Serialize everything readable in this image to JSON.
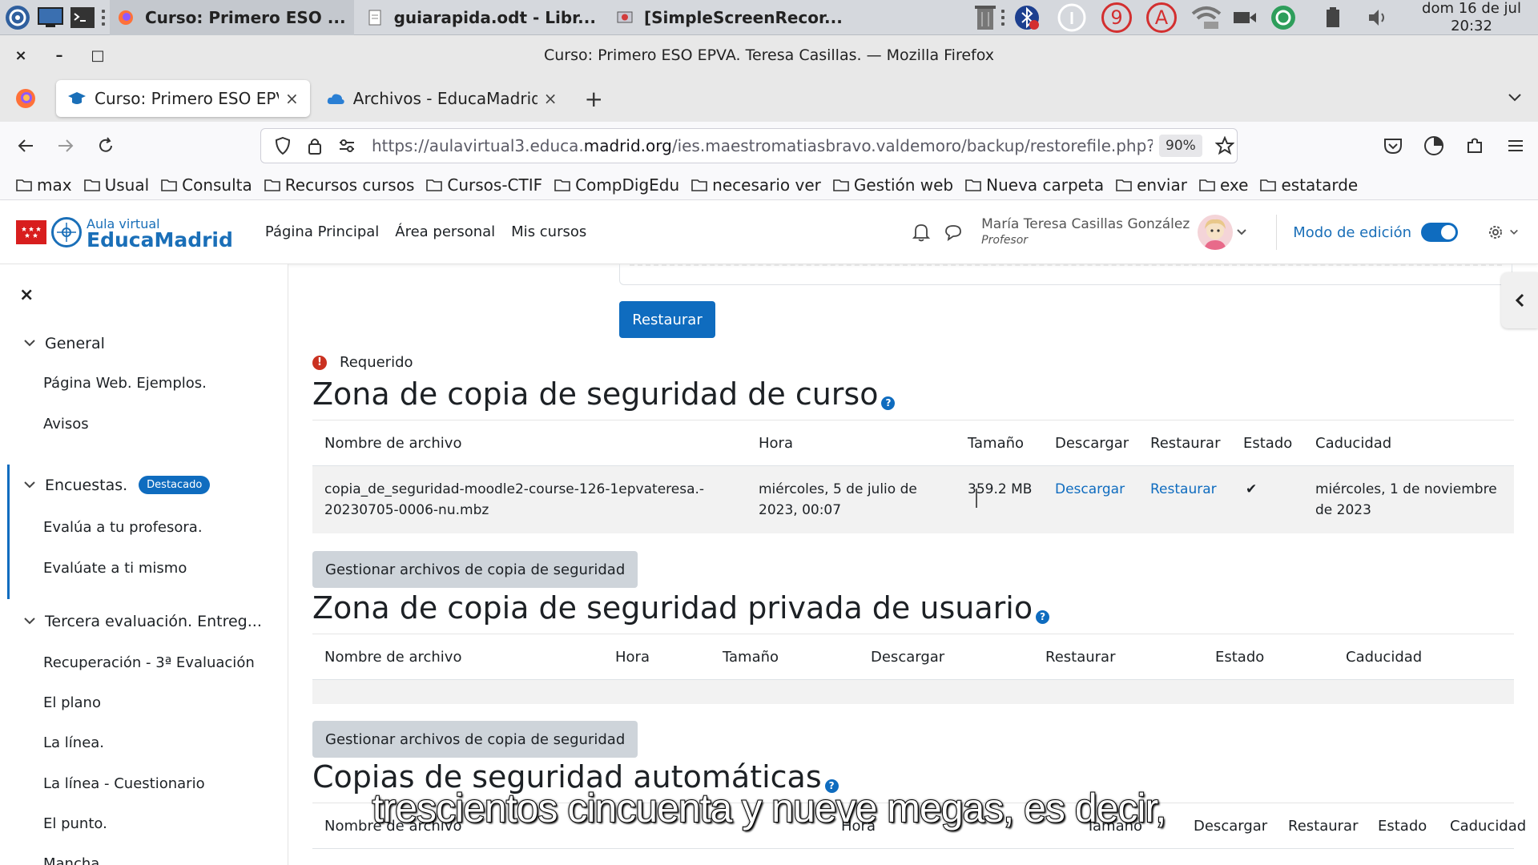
{
  "taskbar": {
    "tasks": [
      {
        "label": "Curso: Primero ESO ..."
      },
      {
        "label": "guiarapida.odt - Libr..."
      },
      {
        "label": "[SimpleScreenRecor..."
      }
    ],
    "tray_badges": {
      "red_number": "9",
      "red_letter": "A"
    },
    "clock_date": "dom 16 de jul",
    "clock_time": "20:32"
  },
  "window": {
    "title": "Curso: Primero ESO EPVA. Teresa Casillas. — Mozilla Firefox",
    "close": "×",
    "minimize": "–",
    "maximize": "□"
  },
  "tabs": [
    {
      "title": "Curso: Primero ESO EPVA",
      "close": "×"
    },
    {
      "title": "Archivos - EducaMadrid C",
      "close": "×"
    }
  ],
  "newtab": "+",
  "urlbar": {
    "prefix": "https://aulavirtual3.educa.",
    "domain": "madrid.org",
    "path": "/ies.maestromatiasbravo.valdemoro/backup/restorefile.php?c",
    "zoom": "90%"
  },
  "bookmarks": [
    "max",
    "Usual",
    "Consulta",
    "Recursos cursos",
    "Cursos-CTIF",
    "CompDigEdu",
    "necesario ver",
    "Gestión web",
    "Nueva carpeta",
    "enviar",
    "exe",
    "estatarde"
  ],
  "moodle_header": {
    "logo_line1": "Aula virtual",
    "logo_line2": "EducaMadrid",
    "nav": [
      "Página Principal",
      "Área personal",
      "Mis cursos"
    ],
    "user_name": "María Teresa Casillas González",
    "user_role": "Profesor",
    "edit_mode_label": "Modo de edición",
    "edit_mode_on": true
  },
  "drawer": {
    "close": "×",
    "sections": [
      {
        "title": "General",
        "items": [
          "Página Web. Ejemplos.",
          "Avisos"
        ]
      },
      {
        "title": "Encuestas.",
        "badge": "Destacado",
        "items": [
          "Evalúa a tu profesora.",
          "Evalúate a ti mismo"
        ]
      },
      {
        "title": "Tercera evaluación. Entreg...",
        "items": [
          "Recuperación - 3ª Evaluación",
          "El plano",
          "La línea.",
          "La línea - Cuestionario",
          "El punto.",
          "Mancha"
        ]
      }
    ]
  },
  "main": {
    "restore_button": "Restaurar",
    "required_label": "Requerido",
    "course_zone": {
      "heading": "Zona de copia de seguridad de curso",
      "headers": [
        "Nombre de archivo",
        "Hora",
        "Tamaño",
        "Descargar",
        "Restaurar",
        "Estado",
        "Caducidad"
      ],
      "row": {
        "filename_line1": "copia_de_seguridad-moodle2-course-126-1epvateresa.-",
        "filename_line2": "20230705-0006-nu.mbz",
        "time_line1": "miércoles, 5 de julio de",
        "time_line2": "2023, 00:07",
        "size": "359.2 MB",
        "download": "Descargar",
        "restore": "Restaurar",
        "status": "✔",
        "expiry_line1": "miércoles, 1 de noviembre",
        "expiry_line2": "de 2023"
      },
      "manage_button": "Gestionar archivos de copia de seguridad"
    },
    "user_zone": {
      "heading": "Zona de copia de seguridad privada de usuario",
      "headers": [
        "Nombre de archivo",
        "Hora",
        "Tamaño",
        "Descargar",
        "Restaurar",
        "Estado",
        "Caducidad"
      ],
      "manage_button": "Gestionar archivos de copia de seguridad"
    },
    "auto_zone": {
      "heading": "Copias de seguridad automáticas",
      "headers": [
        "Nombre de archivo",
        "Hora",
        "Tamaño",
        "Descargar",
        "Restaurar",
        "Estado",
        "Caducidad"
      ]
    }
  },
  "subtitle": "trescientos cincuenta y nueve megas, es decir,",
  "colors": {
    "primary": "#0f6cbf",
    "danger": "#ca3120",
    "educamadrid": "#1a6fb8"
  }
}
